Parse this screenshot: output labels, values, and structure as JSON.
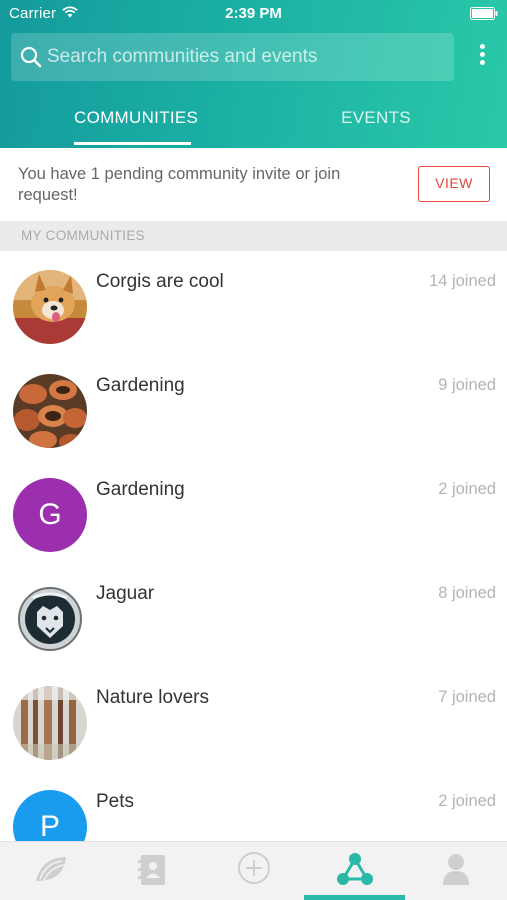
{
  "status_bar": {
    "carrier": "Carrier",
    "time": "2:39 PM"
  },
  "search": {
    "placeholder": "Search communities and events"
  },
  "tabs": [
    {
      "label": "COMMUNITIES",
      "active": true
    },
    {
      "label": "EVENTS",
      "active": false
    }
  ],
  "invite": {
    "text": "You have 1 pending community invite or join request!",
    "button_label": "VIEW"
  },
  "section": {
    "title": "MY COMMUNITIES"
  },
  "communities": [
    {
      "name": "Corgis are cool",
      "joined": "14 joined",
      "avatar": "corgi-photo"
    },
    {
      "name": "Gardening",
      "joined": "9 joined",
      "avatar": "pots-photo"
    },
    {
      "name": "Gardening",
      "joined": "2 joined",
      "avatar": "letter",
      "letter": "G",
      "color": "#9b2fae"
    },
    {
      "name": "Jaguar",
      "joined": "8 joined",
      "avatar": "jaguar-logo"
    },
    {
      "name": "Nature lovers",
      "joined": "7 joined",
      "avatar": "forest-photo"
    },
    {
      "name": "Pets",
      "joined": "2 joined",
      "avatar": "letter",
      "letter": "P",
      "color": "#1a9cee"
    }
  ],
  "bottom_tabs": [
    {
      "icon": "melon-icon",
      "active": false
    },
    {
      "icon": "contacts-book-icon",
      "active": false
    },
    {
      "icon": "add-circle-icon",
      "active": false
    },
    {
      "icon": "communities-network-icon",
      "active": true
    },
    {
      "icon": "profile-icon",
      "active": false
    }
  ],
  "colors": {
    "accent": "#2bb8a6",
    "header_start": "#149a9c",
    "header_end": "#2ac9a8",
    "view_button": "#e8453c"
  }
}
